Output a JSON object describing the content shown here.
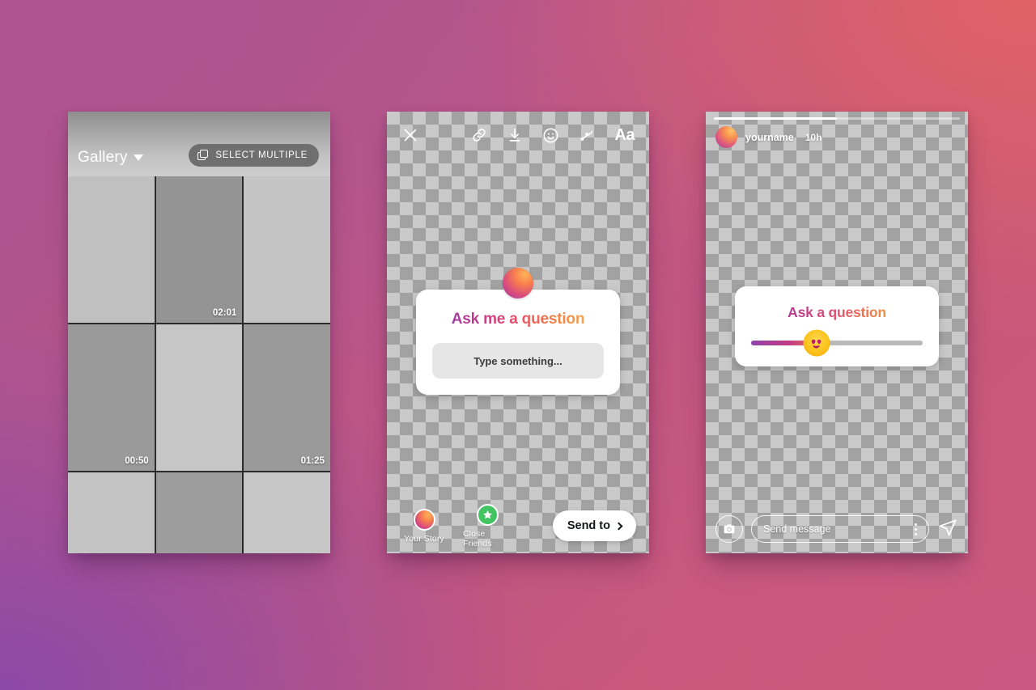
{
  "background": {
    "gradient_colors": [
      "#af548e",
      "#df6068",
      "#8c4ba4",
      "#c45a83"
    ]
  },
  "phones": {
    "gallery": {
      "header": {
        "title": "Gallery",
        "caret_icon": "chevron-down-icon",
        "select_multiple_label": "SELECT MULTIPLE",
        "select_multiple_icon": "copy-layers-icon"
      },
      "grid": {
        "columns": 3,
        "cells": [
          {
            "shade": "#c0c0c0",
            "duration": ""
          },
          {
            "shade": "#949494",
            "duration": "02:01"
          },
          {
            "shade": "#c4c4c4",
            "duration": ""
          },
          {
            "shade": "#9a9a9a",
            "duration": "00:50"
          },
          {
            "shade": "#c6c6c6",
            "duration": ""
          },
          {
            "shade": "#9a9a9a",
            "duration": "01:25"
          },
          {
            "shade": "#c3c3c3",
            "duration": ""
          },
          {
            "shade": "#9d9d9d",
            "duration": ""
          },
          {
            "shade": "#c6c6c6",
            "duration": ""
          }
        ]
      }
    },
    "editor": {
      "toolbar": [
        {
          "name": "close-icon",
          "label": "Close"
        },
        {
          "name": "link-icon",
          "label": "Link"
        },
        {
          "name": "download-icon",
          "label": "Save"
        },
        {
          "name": "sticker-icon",
          "label": "Stickers"
        },
        {
          "name": "draw-icon",
          "label": "Draw"
        },
        {
          "name": "text-icon",
          "label": "Aa"
        }
      ],
      "question_sticker": {
        "title": "Ask me a question",
        "input_placeholder": "Type something...",
        "avatar_icon": "profile-avatar",
        "gradient_from": "#8e44ad",
        "gradient_to": "#fac062"
      },
      "audiences": [
        {
          "label": "Your Story",
          "icon": "your-story-avatar-icon"
        },
        {
          "label": "Close Friends",
          "icon": "close-friends-star-icon"
        }
      ],
      "send_to_label": "Send to",
      "send_to_icon": "chevron-right-icon"
    },
    "viewer": {
      "progress_percent": 50,
      "username": "yourname",
      "timestamp": "10h",
      "avatar_icon": "profile-avatar",
      "slider_sticker": {
        "title": "Ask a question",
        "emoji": "😍",
        "emoji_name": "heart-eyes-emoji",
        "value_percent": 38,
        "track_color": "#b9b9b9",
        "fill_gradient_from": "#8e44ad",
        "fill_gradient_to": "#ef6a5a"
      },
      "bottom_bar": {
        "camera_icon": "camera-icon",
        "message_placeholder": "Send message",
        "more_icon": "kebab-menu-icon",
        "send_icon": "paper-plane-icon"
      }
    }
  }
}
